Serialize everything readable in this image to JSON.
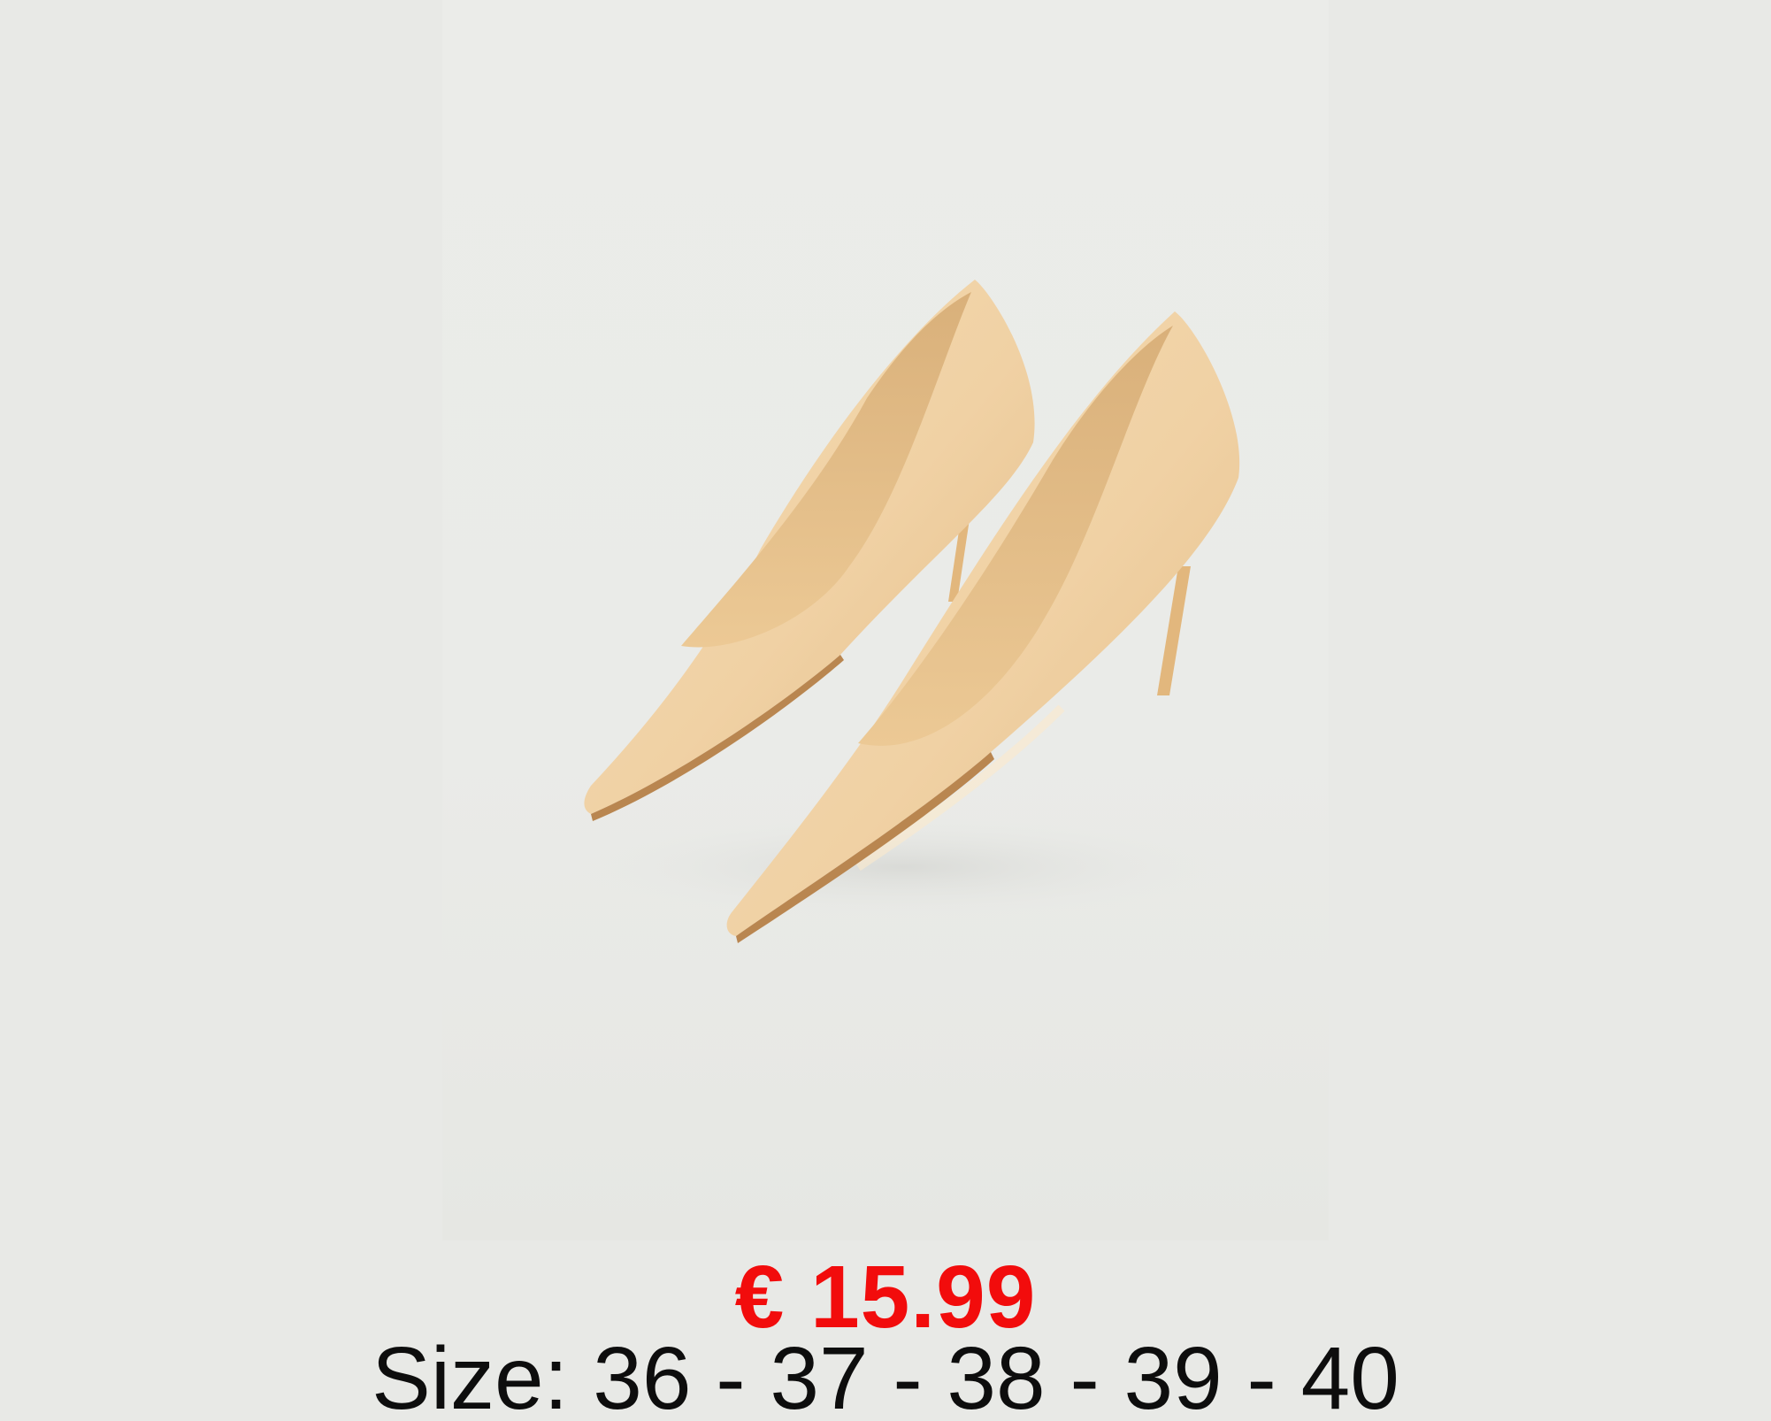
{
  "product": {
    "image_subject": "beige-pointed-toe-pumps",
    "price": "€ 15.99",
    "sizes": "Size: 36 - 37 - 38 - 39 - 40"
  },
  "colors": {
    "background": "#e8e9e6",
    "price": "#f20c0c",
    "text": "#0d0d0d",
    "shoe": "#f0d2a6"
  }
}
